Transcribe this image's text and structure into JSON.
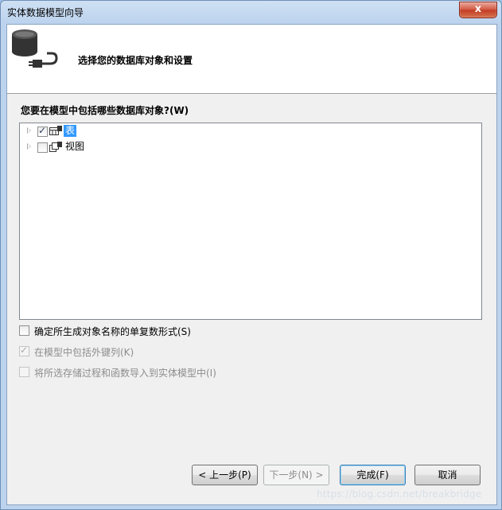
{
  "window": {
    "title": "实体数据模型向导",
    "close_glyph": "x"
  },
  "header": {
    "icon": "database-plug-icon",
    "text": "选择您的数据库对象和设置"
  },
  "question": "您要在模型中包括哪些数据库对象?(W)",
  "tree": {
    "items": [
      {
        "label": "表",
        "checked": true,
        "selected": true,
        "icon": "table-icon"
      },
      {
        "label": "视图",
        "checked": false,
        "selected": false,
        "icon": "view-icon"
      }
    ]
  },
  "options": [
    {
      "label": "确定所生成对象名称的单复数形式(S)",
      "checked": false,
      "enabled": true
    },
    {
      "label": "在模型中包括外键列(K)",
      "checked": true,
      "enabled": false
    },
    {
      "label": "将所选存储过程和函数导入到实体模型中(I)",
      "checked": false,
      "enabled": false
    }
  ],
  "buttons": {
    "back": "< 上一步(P)",
    "next": "下一步(N) >",
    "finish": "完成(F)",
    "cancel": "取消"
  },
  "watermark": "https://blog.csdn.net/breakbridge"
}
